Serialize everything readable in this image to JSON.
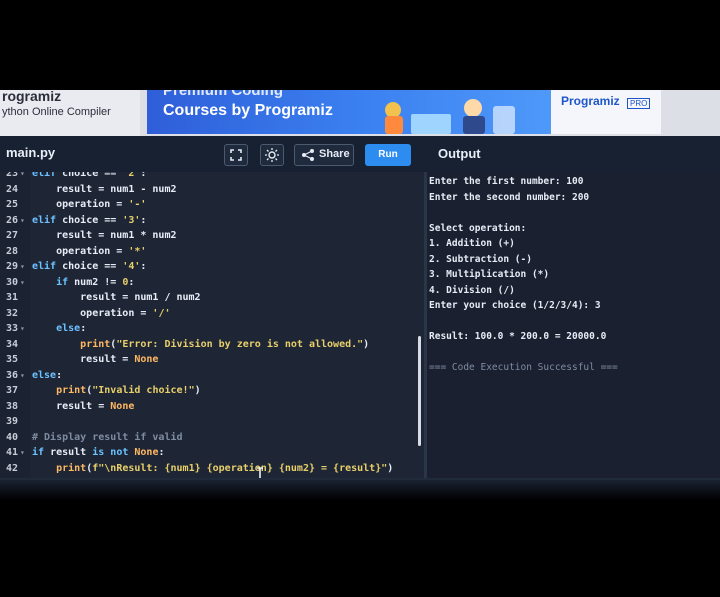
{
  "brand": {
    "line1": "rogramiz",
    "line2": "ython Online Compiler"
  },
  "banner": {
    "caption": "Premium Coding",
    "headline": "Courses by Programiz",
    "logo": "Programiz",
    "badge": "PRO"
  },
  "toolbar": {
    "filename": "main.py",
    "fullscreen_icon": "fullscreen-icon",
    "theme_icon": "sun-icon",
    "share_label": "Share",
    "run_label": "Run",
    "output_title": "Output"
  },
  "editor": {
    "lines": [
      {
        "n": "23",
        "fold": "▾",
        "code": "elif choice == '2':"
      },
      {
        "n": "24",
        "fold": "",
        "code": "    result = num1 - num2"
      },
      {
        "n": "25",
        "fold": "",
        "code": "    operation = '-'"
      },
      {
        "n": "26",
        "fold": "▾",
        "code": "elif choice == '3':"
      },
      {
        "n": "27",
        "fold": "",
        "code": "    result = num1 * num2"
      },
      {
        "n": "28",
        "fold": "",
        "code": "    operation = '*'"
      },
      {
        "n": "29",
        "fold": "▾",
        "code": "elif choice == '4':"
      },
      {
        "n": "30",
        "fold": "▾",
        "code": "    if num2 != 0:"
      },
      {
        "n": "31",
        "fold": "",
        "code": "        result = num1 / num2"
      },
      {
        "n": "32",
        "fold": "",
        "code": "        operation = '/'"
      },
      {
        "n": "33",
        "fold": "▾",
        "code": "    else:"
      },
      {
        "n": "34",
        "fold": "",
        "code": "        print(\"Error: Division by zero is not allowed.\")"
      },
      {
        "n": "35",
        "fold": "",
        "code": "        result = None"
      },
      {
        "n": "36",
        "fold": "▾",
        "code": "else:"
      },
      {
        "n": "37",
        "fold": "",
        "code": "    print(\"Invalid choice!\")"
      },
      {
        "n": "38",
        "fold": "",
        "code": "    result = None"
      },
      {
        "n": "39",
        "fold": "",
        "code": ""
      },
      {
        "n": "40",
        "fold": "",
        "code": "# Display result if valid"
      },
      {
        "n": "41",
        "fold": "▾",
        "code": "if result is not None:"
      },
      {
        "n": "42",
        "fold": "",
        "code": "    print(f\"\\nResult: {num1} {operation} {num2} = {result}\")"
      }
    ]
  },
  "output": {
    "lines": [
      "Enter the first number: 100",
      "Enter the second number: 200",
      "",
      "Select operation:",
      "1. Addition (+)",
      "2. Subtraction (-)",
      "3. Multiplication (*)",
      "4. Division (/)",
      "Enter your choice (1/2/3/4): 3",
      "",
      "Result: 100.0 * 200.0 = 20000.0",
      "",
      "=== Code Execution Successful ==="
    ]
  }
}
